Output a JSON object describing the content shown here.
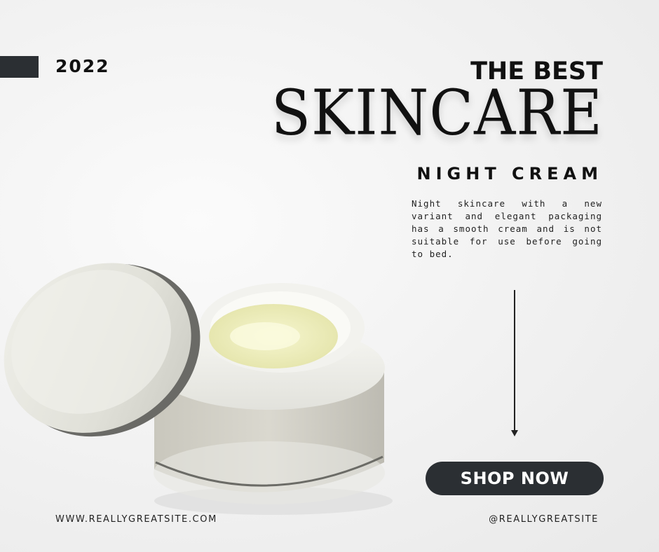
{
  "header": {
    "year": "2022",
    "headline_small": "THE BEST",
    "headline_large": "SKINCARE",
    "subheadline": "NIGHT CREAM"
  },
  "description": "Night skincare with a new variant and elegant packaging has a smooth cream and is not suitable for use before going to bed.",
  "cta": {
    "label": "SHOP NOW"
  },
  "footer": {
    "website": "WWW.REALLYGREATSITE.COM",
    "handle": "@REALLYGREATSITE"
  },
  "colors": {
    "dark": "#2b2f33",
    "background": "#f1f1f1",
    "cream": "#efefb8"
  },
  "icons": {
    "arrow": "arrow-down-icon"
  }
}
